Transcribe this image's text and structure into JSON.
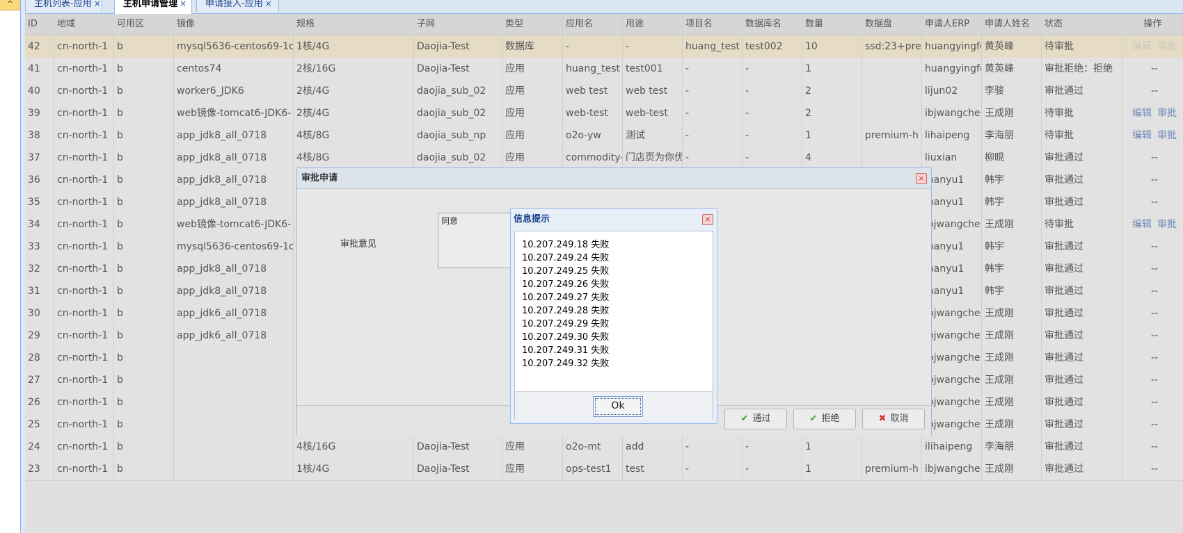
{
  "left_panel": {
    "collapse_glyph": "^"
  },
  "tabs": [
    {
      "label": "主机列表-应用",
      "close": "×"
    },
    {
      "label": "主机申请管理",
      "close": "×"
    },
    {
      "label": "申请接入-应用",
      "close": "×"
    }
  ],
  "grid": {
    "columns": [
      "ID",
      "地域",
      "可用区",
      "镜像",
      "规格",
      "子网",
      "类型",
      "应用名",
      "用途",
      "项目名",
      "数据库名",
      "数量",
      "数据盘",
      "申请人ERP",
      "申请人姓名",
      "状态",
      "操作"
    ],
    "rows": [
      {
        "id": "42",
        "region": "cn-north-1",
        "zone": "b",
        "image": "mysql5636-centos69-1c",
        "spec": "1核/4G",
        "subnet": "Daojia-Test",
        "type": "数据库",
        "app": "-",
        "usage": "-",
        "project": "huang_test",
        "db": "test002",
        "qty": "10",
        "disk": "ssd:23+pre",
        "erp": "huangyingfe",
        "name": "黄英峰",
        "status": "待审批",
        "ops": [
          "编辑",
          "审批"
        ],
        "ops_style": "faded",
        "highlight": true
      },
      {
        "id": "41",
        "region": "cn-north-1",
        "zone": "b",
        "image": "centos74",
        "spec": "2核/16G",
        "subnet": "Daojia-Test",
        "type": "应用",
        "app": "huang_test",
        "usage": "test001",
        "project": "-",
        "db": "-",
        "qty": "1",
        "disk": "",
        "erp": "huangyingfe",
        "name": "黄英峰",
        "status": "审批拒绝：拒绝",
        "ops": [
          "--"
        ]
      },
      {
        "id": "40",
        "region": "cn-north-1",
        "zone": "b",
        "image": "worker6_JDK6",
        "spec": "2核/4G",
        "subnet": "daojia_sub_02",
        "type": "应用",
        "app": "web test",
        "usage": "web test",
        "project": "-",
        "db": "-",
        "qty": "2",
        "disk": "",
        "erp": "lijun02",
        "name": "李骏",
        "status": "审批通过",
        "ops": [
          "--"
        ]
      },
      {
        "id": "39",
        "region": "cn-north-1",
        "zone": "b",
        "image": "web镜像-tomcat6-JDK6-",
        "spec": "2核/4G",
        "subnet": "daojia_sub_02",
        "type": "应用",
        "app": "web-test",
        "usage": "web-test",
        "project": "-",
        "db": "-",
        "qty": "2",
        "disk": "",
        "erp": "ibjwangche",
        "name": "王成刚",
        "status": "待审批",
        "ops": [
          "编辑",
          "审批"
        ]
      },
      {
        "id": "38",
        "region": "cn-north-1",
        "zone": "b",
        "image": "app_jdk8_all_0718",
        "spec": "4核/8G",
        "subnet": "daojia_sub_np",
        "type": "应用",
        "app": "o2o-yw",
        "usage": "测试",
        "project": "-",
        "db": "-",
        "qty": "1",
        "disk": "premium-h",
        "erp": "lihaipeng",
        "name": "李海朋",
        "status": "待审批",
        "ops": [
          "编辑",
          "审批"
        ]
      },
      {
        "id": "37",
        "region": "cn-north-1",
        "zone": "b",
        "image": "app_jdk8_all_0718",
        "spec": "4核/8G",
        "subnet": "daojia_sub_02",
        "type": "应用",
        "app": "commodity-",
        "usage": "门店页为你优",
        "project": "-",
        "db": "-",
        "qty": "4",
        "disk": "",
        "erp": "liuxian",
        "name": "柳晛",
        "status": "审批通过",
        "ops": [
          "--"
        ]
      },
      {
        "id": "36",
        "region": "cn-north-1",
        "zone": "b",
        "image": "app_jdk8_all_0718",
        "spec": "",
        "subnet": "",
        "type": "",
        "app": "",
        "usage": "",
        "project": "",
        "db": "",
        "qty": "",
        "disk": "",
        "erp": "jhanyu1",
        "name": "韩宇",
        "status": "审批通过",
        "ops": [
          "--"
        ]
      },
      {
        "id": "35",
        "region": "cn-north-1",
        "zone": "b",
        "image": "app_jdk8_all_0718",
        "spec": "",
        "subnet": "",
        "type": "",
        "app": "",
        "usage": "",
        "project": "",
        "db": "",
        "qty": "",
        "disk": "",
        "erp": "jhanyu1",
        "name": "韩宇",
        "status": "审批通过",
        "ops": [
          "--"
        ]
      },
      {
        "id": "34",
        "region": "cn-north-1",
        "zone": "b",
        "image": "web镜像-tomcat6-JDK6-",
        "spec": "",
        "subnet": "",
        "type": "",
        "app": "",
        "usage": "",
        "project": "",
        "db": "",
        "qty": "",
        "disk": "",
        "erp": "ibjwangche",
        "name": "王成刚",
        "status": "待审批",
        "ops": [
          "编辑",
          "审批"
        ]
      },
      {
        "id": "33",
        "region": "cn-north-1",
        "zone": "b",
        "image": "mysql5636-centos69-1c",
        "spec": "",
        "subnet": "",
        "type": "",
        "app": "",
        "usage": "",
        "project": "",
        "db": "",
        "qty": "",
        "disk": "",
        "erp": "jhanyu1",
        "name": "韩宇",
        "status": "审批通过",
        "ops": [
          "--"
        ]
      },
      {
        "id": "32",
        "region": "cn-north-1",
        "zone": "b",
        "image": "app_jdk8_all_0718",
        "spec": "",
        "subnet": "",
        "type": "",
        "app": "",
        "usage": "",
        "project": "",
        "db": "",
        "qty": "",
        "disk": "",
        "erp": "jhanyu1",
        "name": "韩宇",
        "status": "审批通过",
        "ops": [
          "--"
        ]
      },
      {
        "id": "31",
        "region": "cn-north-1",
        "zone": "b",
        "image": "app_jdk8_all_0718",
        "spec": "",
        "subnet": "",
        "type": "",
        "app": "",
        "usage": "",
        "project": "",
        "db": "",
        "qty": "",
        "disk": "",
        "erp": "jhanyu1",
        "name": "韩宇",
        "status": "审批通过",
        "ops": [
          "--"
        ]
      },
      {
        "id": "30",
        "region": "cn-north-1",
        "zone": "b",
        "image": "app_jdk6_all_0718",
        "spec": "",
        "subnet": "",
        "type": "",
        "app": "",
        "usage": "",
        "project": "",
        "db": "",
        "qty": "",
        "disk": "",
        "erp": "ibjwangche",
        "name": "王成刚",
        "status": "审批通过",
        "ops": [
          "--"
        ]
      },
      {
        "id": "29",
        "region": "cn-north-1",
        "zone": "b",
        "image": "app_jdk6_all_0718",
        "spec": "",
        "subnet": "",
        "type": "",
        "app": "",
        "usage": "",
        "project": "",
        "db": "",
        "qty": "",
        "disk": "",
        "erp": "ibjwangche",
        "name": "王成刚",
        "status": "审批通过",
        "ops": [
          "--"
        ]
      },
      {
        "id": "28",
        "region": "cn-north-1",
        "zone": "b",
        "image": "",
        "spec": "",
        "subnet": "",
        "type": "",
        "app": "",
        "usage": "",
        "project": "",
        "db": "",
        "qty": "",
        "disk": "",
        "erp": "ibjwangche",
        "name": "王成刚",
        "status": "审批通过",
        "ops": [
          "--"
        ]
      },
      {
        "id": "27",
        "region": "cn-north-1",
        "zone": "b",
        "image": "",
        "spec": "",
        "subnet": "",
        "type": "",
        "app": "",
        "usage": "",
        "project": "",
        "db": "",
        "qty": "",
        "disk": "",
        "erp": "ibjwangche",
        "name": "王成刚",
        "status": "审批通过",
        "ops": [
          "--"
        ]
      },
      {
        "id": "26",
        "region": "cn-north-1",
        "zone": "b",
        "image": "",
        "spec": "",
        "subnet": "",
        "type": "",
        "app": "",
        "usage": "",
        "project": "",
        "db": "",
        "qty": "",
        "disk": "",
        "erp": "ibjwangche",
        "name": "王成刚",
        "status": "审批通过",
        "ops": [
          "--"
        ]
      },
      {
        "id": "25",
        "region": "cn-north-1",
        "zone": "b",
        "image": "",
        "spec": "",
        "subnet": "",
        "type": "",
        "app": "",
        "usage": "",
        "project": "",
        "db": "",
        "qty": "",
        "disk": "",
        "erp": "ibjwangche",
        "name": "王成刚",
        "status": "审批通过",
        "ops": [
          "--"
        ]
      },
      {
        "id": "24",
        "region": "cn-north-1",
        "zone": "b",
        "image": "",
        "spec": "4核/16G",
        "subnet": "Daojia-Test",
        "type": "应用",
        "app": "o2o-mt",
        "usage": "add",
        "project": "-",
        "db": "-",
        "qty": "1",
        "disk": "",
        "erp": "ilihaipeng",
        "name": "李海朋",
        "status": "审批通过",
        "ops": [
          "--"
        ]
      },
      {
        "id": "23",
        "region": "cn-north-1",
        "zone": "b",
        "image": "",
        "spec": "1核/4G",
        "subnet": "Daojia-Test",
        "type": "应用",
        "app": "ops-test1",
        "usage": "test",
        "project": "-",
        "db": "-",
        "qty": "1",
        "disk": "premium-h",
        "erp": "ibjwangche",
        "name": "王成刚",
        "status": "审批通过",
        "ops": [
          "--"
        ]
      }
    ]
  },
  "approval_dialog": {
    "title": "审批申请",
    "close": "×",
    "opinion_label": "审批意见",
    "opinion_value": "同意",
    "buttons": {
      "approve": "通过",
      "reject": "拒绝",
      "cancel": "取消"
    }
  },
  "message_box": {
    "title": "信息提示",
    "close": "×",
    "lines": [
      "10.207.249.18 失败",
      "10.207.249.24 失败",
      "10.207.249.25 失败",
      "10.207.249.26 失败",
      "10.207.249.27 失败",
      "10.207.249.28 失败",
      "10.207.249.29 失败",
      "10.207.249.30 失败",
      "10.207.249.31 失败",
      "10.207.249.32 失败"
    ],
    "ok_label": "Ok"
  }
}
